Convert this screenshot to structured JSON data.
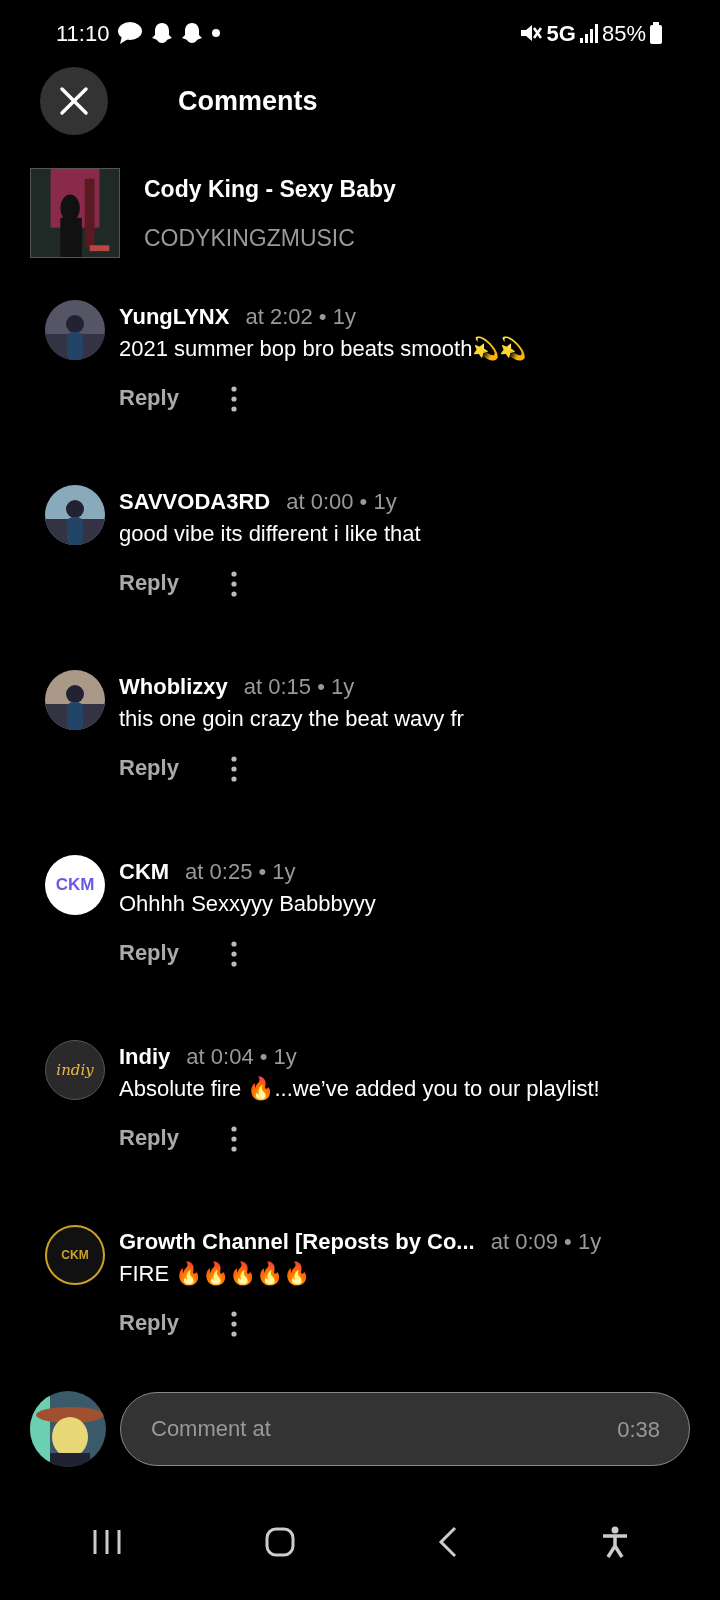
{
  "status_bar": {
    "time": "11:10",
    "network": "5G",
    "battery": "85%"
  },
  "header": {
    "title": "Comments"
  },
  "track": {
    "title": "Cody King - Sexy Baby",
    "artist": "CODYKINGZMUSIC"
  },
  "comments": [
    {
      "user": "YungLYNX",
      "meta": "at 2:02 • 1y",
      "text": "2021 summer bop bro beats smooth💫💫",
      "reply": "Reply"
    },
    {
      "user": "SAVVODA3RD",
      "meta": "at 0:00 • 1y",
      "text": "good vibe its different i like that",
      "reply": "Reply"
    },
    {
      "user": "Whoblizxy",
      "meta": "at 0:15 • 1y",
      "text": "this one goin crazy the beat wavy fr",
      "reply": "Reply"
    },
    {
      "user": "CKM",
      "meta": "at 0:25 • 1y",
      "text": "Ohhhh Sexxyyy Babbbyyy",
      "avatar": {
        "kind": "logo",
        "text": "CKM"
      },
      "reply": "Reply"
    },
    {
      "user": "Indiy",
      "meta": "at 0:04 • 1y",
      "text": "Absolute fire 🔥...we’ve added you to our playlist!",
      "avatar": {
        "kind": "script",
        "text": "indiy"
      },
      "reply": "Reply"
    },
    {
      "user": "Growth Channel [Reposts by Co...",
      "meta": "at 0:09 • 1y",
      "text": "FIRE 🔥🔥🔥🔥🔥",
      "avatar": {
        "kind": "crest",
        "text": "CKM"
      },
      "reply": "Reply"
    }
  ],
  "composer": {
    "placeholder": "Comment at",
    "timestamp": "0:38"
  }
}
